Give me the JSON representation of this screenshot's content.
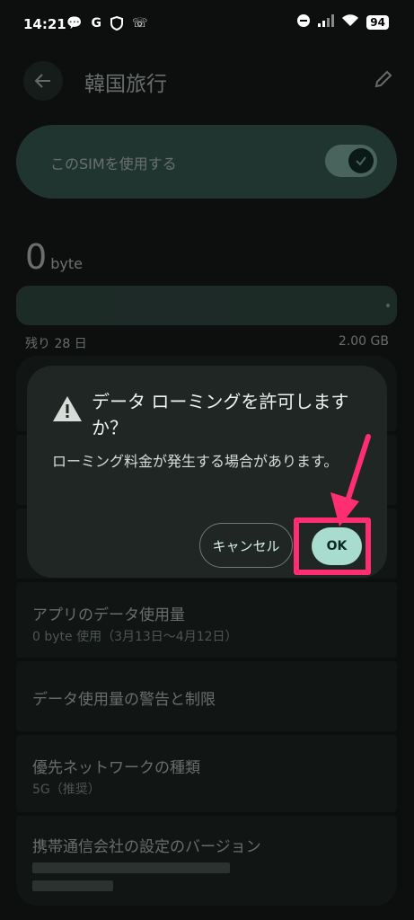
{
  "status_bar": {
    "time": "14:21",
    "left_icons": [
      "chat-icon",
      "G",
      "shield-icon",
      "phone-icon"
    ],
    "battery": "94"
  },
  "header": {
    "title": "韓国旅行"
  },
  "sim_toggle": {
    "label": "このSIMを使用する",
    "enabled": true
  },
  "usage": {
    "value": "0",
    "unit": "byte",
    "days_left": "残り 28 日",
    "cap": "2.00 GB",
    "used_fraction": 0.0
  },
  "rows": {
    "row1_title": "",
    "app_data_title": "アプリのデータ使用量",
    "app_data_sub": "0 byte 使用（3月13日〜4月12日）",
    "warning_title": "データ使用量の警告と制限",
    "network_title": "優先ネットワークの種類",
    "network_sub": "5G（推奨）",
    "carrier_title": "携帯通信会社の設定のバージョン"
  },
  "dialog": {
    "title": "データ ローミングを許可しますか？",
    "body": "ローミング料金が発生する場合があります。",
    "cancel_label": "キャンセル",
    "ok_label": "OK"
  },
  "colors": {
    "accent": "#a7dccf",
    "highlight": "#ff2d72",
    "toggle_on": "#9ed9c8"
  }
}
